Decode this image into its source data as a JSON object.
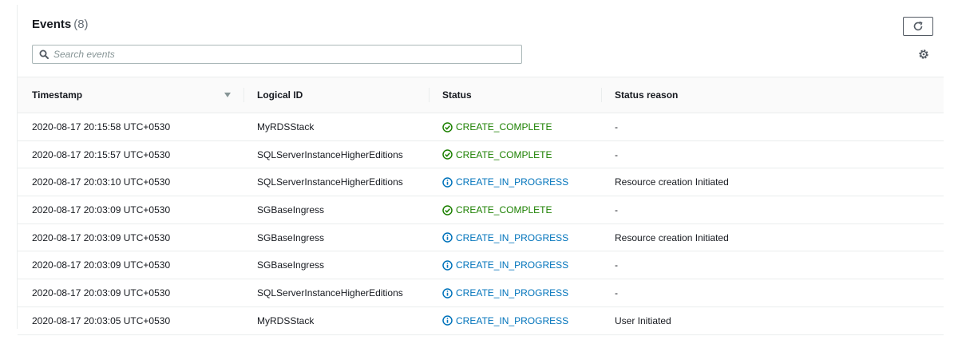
{
  "events": {
    "title": "Events",
    "count": "(8)",
    "search_placeholder": "Search events",
    "refresh_icon": "refresh-icon",
    "settings_icon": "gear-icon",
    "columns": {
      "timestamp": "Timestamp",
      "logical_id": "Logical ID",
      "status": "Status",
      "status_reason": "Status reason"
    },
    "rows": [
      {
        "timestamp": "2020-08-17 20:15:58 UTC+0530",
        "logical_id": "MyRDSStack",
        "status": "CREATE_COMPLETE",
        "status_reason": "-"
      },
      {
        "timestamp": "2020-08-17 20:15:57 UTC+0530",
        "logical_id": "SQLServerInstanceHigherEditions",
        "status": "CREATE_COMPLETE",
        "status_reason": "-"
      },
      {
        "timestamp": "2020-08-17 20:03:10 UTC+0530",
        "logical_id": "SQLServerInstanceHigherEditions",
        "status": "CREATE_IN_PROGRESS",
        "status_reason": "Resource creation Initiated"
      },
      {
        "timestamp": "2020-08-17 20:03:09 UTC+0530",
        "logical_id": "SGBaseIngress",
        "status": "CREATE_COMPLETE",
        "status_reason": "-"
      },
      {
        "timestamp": "2020-08-17 20:03:09 UTC+0530",
        "logical_id": "SGBaseIngress",
        "status": "CREATE_IN_PROGRESS",
        "status_reason": "Resource creation Initiated"
      },
      {
        "timestamp": "2020-08-17 20:03:09 UTC+0530",
        "logical_id": "SGBaseIngress",
        "status": "CREATE_IN_PROGRESS",
        "status_reason": "-"
      },
      {
        "timestamp": "2020-08-17 20:03:09 UTC+0530",
        "logical_id": "SQLServerInstanceHigherEditions",
        "status": "CREATE_IN_PROGRESS",
        "status_reason": "-"
      },
      {
        "timestamp": "2020-08-17 20:03:05 UTC+0530",
        "logical_id": "MyRDSStack",
        "status": "CREATE_IN_PROGRESS",
        "status_reason": "User Initiated"
      }
    ]
  },
  "colors": {
    "complete": "#1d8102",
    "in_progress": "#0073bb",
    "border": "#eaeded",
    "header_bg": "#fafafa"
  }
}
